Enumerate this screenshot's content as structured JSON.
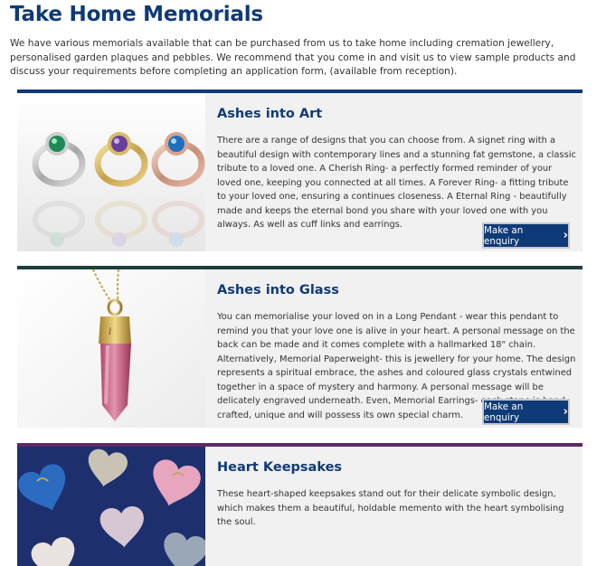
{
  "page": {
    "title": "Take Home Memorials",
    "intro": "We have various memorials available that can be purchased from us to take home including cremation jewellery, personalised garden plaques and pebbles. We recommend that you come in and visit us to view sample products and discuss your requirements before completing an application form, (available from reception)."
  },
  "cards": [
    {
      "title": "Ashes into Art",
      "text": "There are a range of designs that you can choose from. A signet ring with a beautiful design with contemporary lines and a stunning fat gemstone, a classic tribute to a loved one. A Cherish Ring- a perfectly formed reminder of your loved one, keeping you connected at all times. A Forever Ring- a fitting tribute to your loved one, ensuring a continues closeness. A Eternal Ring - beautifully made and keeps the eternal bond you share with your loved one with you always. As well as cuff links and earrings.",
      "button": "Make an enquiry",
      "accent": "#0f3a78"
    },
    {
      "title": "Ashes into Glass",
      "text": "You can memorialise your loved on in a Long Pendant - wear this pendant to remind you that your love one is alive in your heart. A personal message on the back can be made and it comes complete with a hallmarked 18\" chain. Alternatively, Memorial Paperweight- this is jewellery for your home. The design represents a spiritual embrace, the ashes and coloured glass crystals entwined together in a space of mystery and harmony. A personal message will be delicately engraved underneath. Even, Memorial Earrings- each stone is hand-crafted, unique and will possess its own special charm.",
      "button": "Make an enquiry",
      "accent": "#1e3f3c"
    },
    {
      "title": "Heart Keepsakes",
      "text": "These heart-shaped keepsakes stand out for their delicate symbolic design, which makes them a beautiful, holdable memento with the heart symbolising the soul.",
      "accent": "#5c2a64"
    }
  ]
}
